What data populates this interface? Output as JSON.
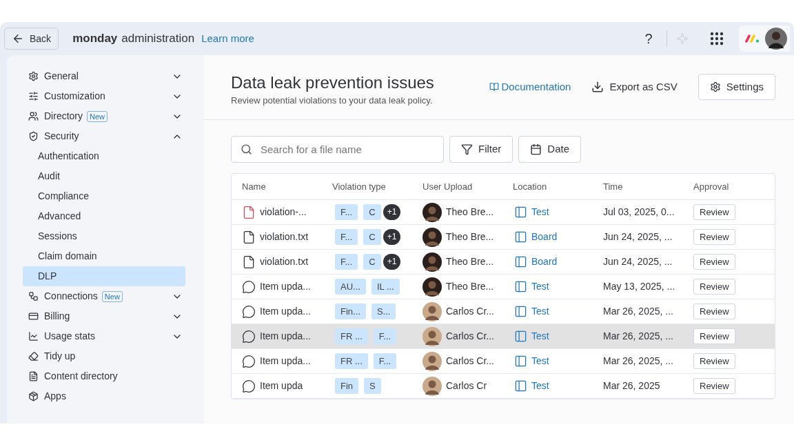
{
  "topbar": {
    "back": "Back",
    "brand": "monday",
    "title": "administration",
    "learn_more": "Learn more",
    "help": "?"
  },
  "sidebar": {
    "items": [
      {
        "label": "General",
        "expanded": false
      },
      {
        "label": "Customization",
        "expanded": false
      },
      {
        "label": "Directory",
        "badge": "New",
        "expanded": false
      },
      {
        "label": "Security",
        "expanded": true,
        "children": [
          {
            "label": "Authentication",
            "selected": false
          },
          {
            "label": "Audit",
            "selected": false
          },
          {
            "label": "Compliance",
            "selected": false
          },
          {
            "label": "Advanced",
            "selected": false
          },
          {
            "label": "Sessions",
            "selected": false
          },
          {
            "label": "Claim domain",
            "selected": false
          },
          {
            "label": "DLP",
            "selected": true
          }
        ]
      },
      {
        "label": "Connections",
        "badge": "New",
        "expanded": false
      },
      {
        "label": "Billing",
        "expanded": false
      },
      {
        "label": "Usage stats",
        "expanded": false
      },
      {
        "label": "Tidy up"
      },
      {
        "label": "Content directory"
      },
      {
        "label": "Apps"
      }
    ]
  },
  "header": {
    "title": "Data leak prevention issues",
    "subtitle": "Review potential violations to your data leak policy.",
    "documentation": "Documentation",
    "export": "Export as CSV",
    "settings": "Settings"
  },
  "toolbar": {
    "search": {
      "placeholder": "Search for a file name"
    },
    "filter": "Filter",
    "date": "Date"
  },
  "table": {
    "columns": [
      "Name",
      "Violation type",
      "User Upload",
      "Location",
      "Time",
      "Approval"
    ],
    "rows": [
      {
        "kind": "pdf",
        "name": "violation-...",
        "tags": [
          "F...",
          "C"
        ],
        "extra": "+1",
        "user": "Theo Bre...",
        "color": "#2a1f1a",
        "location": "Test",
        "time": "Jul 03, 2025, 0...",
        "action": "Review",
        "hovered": false
      },
      {
        "kind": "file",
        "name": "violation.txt",
        "tags": [
          "F...",
          "C"
        ],
        "extra": "+1",
        "user": "Theo Bre...",
        "color": "#2a1f1a",
        "location": "Board",
        "time": "Jun 24, 2025, ...",
        "action": "Review",
        "hovered": false
      },
      {
        "kind": "file",
        "name": "violation.txt",
        "tags": [
          "F...",
          "C"
        ],
        "extra": "+1",
        "user": "Theo Bre...",
        "color": "#2a1f1a",
        "location": "Board",
        "time": "Jun 24, 2025, ...",
        "action": "Review",
        "hovered": false
      },
      {
        "kind": "comment",
        "name": "Item upda...",
        "tags": [
          "AU...",
          "IL ..."
        ],
        "user": "Theo Bre...",
        "color": "#2a1f1a",
        "location": "Test",
        "time": "May 13, 2025, ...",
        "action": "Review",
        "hovered": false
      },
      {
        "kind": "comment",
        "name": "Item upda...",
        "tags": [
          "Fin...",
          "S..."
        ],
        "user": "Carlos Cr...",
        "color": "#c9a98a",
        "location": "Test",
        "time": "Mar 26, 2025, ...",
        "action": "Review",
        "hovered": false
      },
      {
        "kind": "comment",
        "name": "Item upda...",
        "tags": [
          "FR ...",
          "F..."
        ],
        "user": "Carlos Cr...",
        "color": "#c9a98a",
        "location": "Test",
        "time": "Mar 26, 2025, ...",
        "action": "Review",
        "hovered": true
      },
      {
        "kind": "comment",
        "name": "Item upda...",
        "tags": [
          "FR ...",
          "F..."
        ],
        "user": "Carlos Cr...",
        "color": "#c9a98a",
        "location": "Test",
        "time": "Mar 26, 2025, ...",
        "action": "Review",
        "hovered": false
      },
      {
        "kind": "comment",
        "name": "Item upda",
        "tags": [
          "Fin",
          "S"
        ],
        "user": "Carlos Cr",
        "color": "#c9a98a",
        "location": "Test",
        "time": "Mar 26, 2025",
        "action": "Review",
        "hovered": false
      }
    ]
  }
}
